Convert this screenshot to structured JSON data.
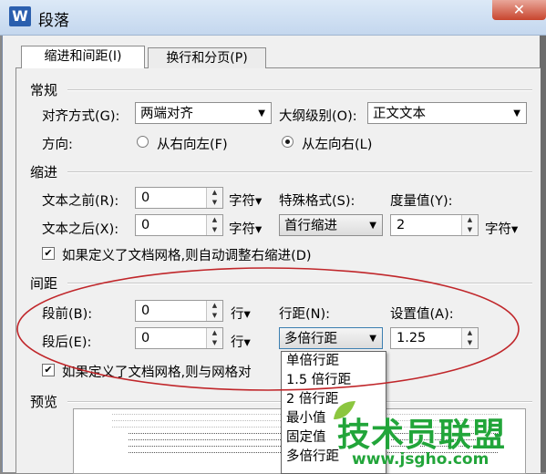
{
  "window": {
    "title": "段落",
    "app_icon_letter": "W",
    "close_glyph": "✕"
  },
  "tabs": [
    {
      "label": "缩进和间距(I)",
      "active": true
    },
    {
      "label": "换行和分页(P)",
      "active": false
    }
  ],
  "general": {
    "title": "常规",
    "alignment_label": "对齐方式(G):",
    "alignment_value": "两端对齐",
    "outline_label": "大纲级别(O):",
    "outline_value": "正文文本",
    "direction_label": "方向:",
    "rtl_label": "从右向左(F)",
    "ltr_label": "从左向右(L)"
  },
  "indent": {
    "title": "缩进",
    "before_label": "文本之前(R):",
    "before_value": "0",
    "after_label": "文本之后(X):",
    "after_value": "0",
    "unit": "字符▾",
    "special_label": "特殊格式(S):",
    "special_value": "首行缩进",
    "measure_label": "度量值(Y):",
    "measure_value": "2",
    "auto_adjust_label": "如果定义了文档网格,则自动调整右缩进(D)"
  },
  "spacing": {
    "title": "间距",
    "before_label": "段前(B):",
    "before_value": "0",
    "after_label": "段后(E):",
    "after_value": "0",
    "unit": "行▾",
    "line_spacing_label": "行距(N):",
    "line_spacing_value": "多倍行距",
    "set_value_label": "设置值(A):",
    "set_value": "1.25",
    "snap_grid_label": "如果定义了文档网格,则与网格对"
  },
  "line_spacing_options": [
    "单倍行距",
    "1.5 倍行距",
    "2 倍行距",
    "最小值",
    "固定值",
    "多倍行距"
  ],
  "preview": {
    "title": "预览"
  },
  "watermark": {
    "text": "技术员联盟",
    "url": "www.jsgho.com"
  },
  "colors": {
    "annotation_ellipse": "#c0262a",
    "watermark_green": "#22a53a",
    "selection": "#3399ff"
  }
}
